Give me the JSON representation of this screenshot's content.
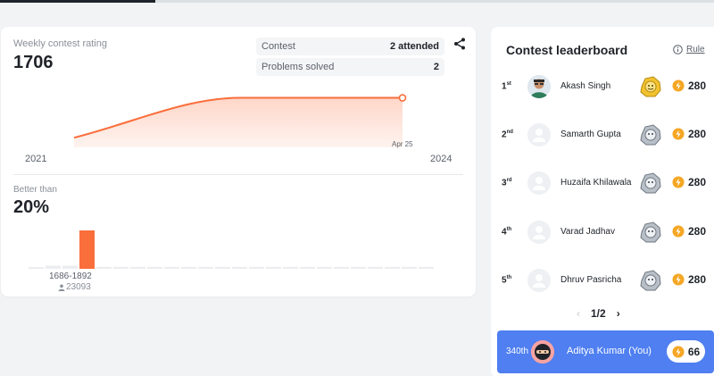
{
  "rating": {
    "label": "Weekly contest rating",
    "value": "1706",
    "stats": [
      {
        "label": "Contest",
        "value": "2 attended"
      },
      {
        "label": "Problems solved",
        "value": "2"
      }
    ],
    "point_label": "Apr 25",
    "x_start": "2021",
    "x_end": "2024"
  },
  "better": {
    "label": "Better than",
    "value": "20%",
    "range": "1686-1892",
    "count": "23093"
  },
  "chart_data": [
    {
      "type": "line",
      "title": "Weekly contest rating",
      "xlabel": "",
      "ylabel": "",
      "x": [
        "2021",
        "Apr 25",
        "2024"
      ],
      "series": [
        {
          "values": [
            1500,
            1706,
            1706
          ]
        }
      ],
      "grid": false,
      "highlight_point": "Apr 25"
    },
    {
      "type": "bar",
      "title": "Better than",
      "categories": [
        "b1",
        "b2",
        "b3",
        "1686-1892",
        "b5",
        "b6",
        "b7",
        "b8",
        "b9",
        "b10",
        "b11",
        "b12",
        "b13",
        "b14",
        "b15",
        "b16",
        "b17",
        "b18",
        "b19",
        "b20",
        "b21",
        "b22",
        "b23",
        "b24"
      ],
      "values": [
        2,
        5,
        5,
        60,
        3,
        3,
        3,
        3,
        3,
        3,
        3,
        3,
        3,
        3,
        3,
        3,
        3,
        3,
        3,
        3,
        3,
        3,
        3,
        3
      ],
      "highlight_index": 3,
      "ylim": [
        0,
        60
      ]
    }
  ],
  "leaderboard": {
    "title": "Contest leaderboard",
    "rule_label": "Rule",
    "rows": [
      {
        "rank": "1",
        "suffix": "st",
        "name": "Akash Singh",
        "points": "280"
      },
      {
        "rank": "2",
        "suffix": "nd",
        "name": "Samarth Gupta",
        "points": "280"
      },
      {
        "rank": "3",
        "suffix": "rd",
        "name": "Huzaifa Khilawala",
        "points": "280"
      },
      {
        "rank": "4",
        "suffix": "th",
        "name": "Varad Jadhav",
        "points": "280"
      },
      {
        "rank": "5",
        "suffix": "th",
        "name": "Dhruv Pasricha",
        "points": "280"
      }
    ],
    "page": "1/2",
    "prev_icon": "chevron-left-icon",
    "next_icon": "chevron-right-icon"
  },
  "me": {
    "rank": "340th",
    "name": "Aditya Kumar (You)",
    "points": "66"
  },
  "colors": {
    "accent": "#fa6e3c",
    "highlight_row": "#4f7ff0",
    "coin": "#f5a623"
  }
}
